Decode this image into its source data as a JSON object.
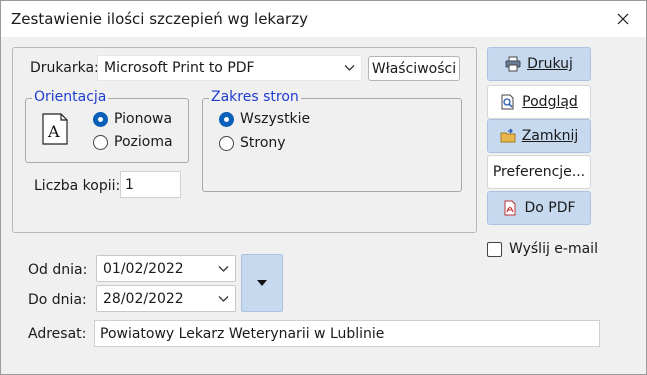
{
  "window": {
    "title": "Zestawienie ilości szczepień wg lekarzy"
  },
  "printer": {
    "label": "Drukarka:",
    "value": "Microsoft Print to PDF",
    "properties_label": "Właściwości"
  },
  "orientation": {
    "legend": "Orientacja",
    "options": [
      "Pionowa",
      "Pozioma"
    ],
    "selected": "Pionowa"
  },
  "page_range": {
    "legend": "Zakres stron",
    "options": [
      "Wszystkie",
      "Strony"
    ],
    "selected": "Wszystkie"
  },
  "copies": {
    "label": "Liczba kopii:",
    "value": "1"
  },
  "actions": {
    "print": "Drukuj",
    "preview": "Podgląd",
    "close": "Zamknij",
    "preferences": "Preferencje...",
    "pdf": "Do PDF"
  },
  "email": {
    "label": "Wyślij e-mail",
    "checked": false
  },
  "dates": {
    "from_label": "Od dnia:",
    "from_value": "01/02/2022",
    "to_label": "Do dnia:",
    "to_value": "28/02/2022"
  },
  "recipient": {
    "label": "Adresat:",
    "value": "Powiatowy Lekarz Weterynarii w Lublinie"
  },
  "icons": {
    "close": "close-icon",
    "print": "printer-icon",
    "preview": "preview-icon",
    "exit": "folder-exit-icon",
    "pdf": "pdf-icon",
    "orientation": "portrait-page-icon",
    "dropdown": "chevron-down-icon"
  },
  "colors": {
    "accent": "#0a5fb8",
    "button_blue": "#c7d9ef",
    "legend_text": "#1f3dd0"
  }
}
